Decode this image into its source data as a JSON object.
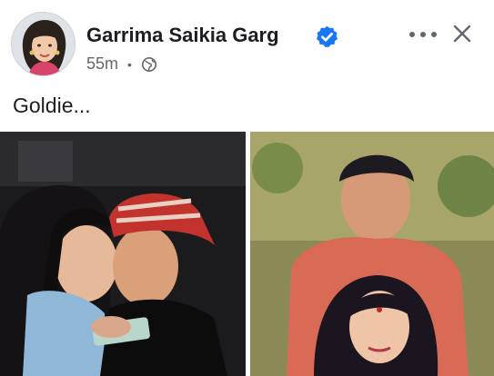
{
  "post": {
    "author": "Garrima Saikia Garg",
    "time": "55m",
    "separator": "•",
    "text": "Goldie..."
  },
  "icons": {
    "verified": "verified-badge-icon",
    "audience": "globe-icon",
    "more": "more-options-icon",
    "close": "close-icon"
  },
  "colors": {
    "verified_blue": "#1877f2",
    "text_primary": "#1c1e21",
    "text_secondary": "#65676b"
  }
}
